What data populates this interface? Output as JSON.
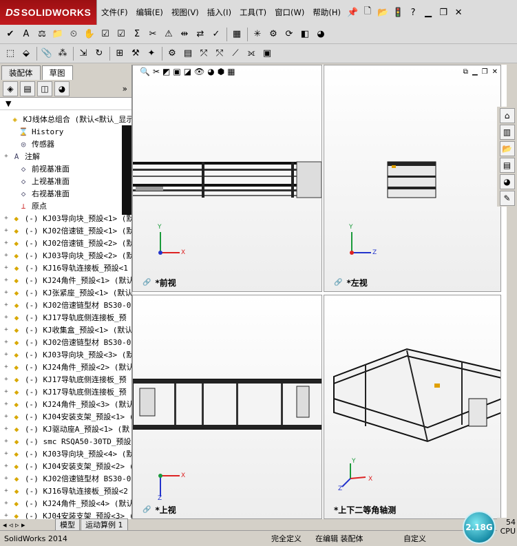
{
  "app": {
    "logo_ds": "DS",
    "logo_name": "SOLIDWORKS"
  },
  "menu": [
    "文件(F)",
    "编辑(E)",
    "视图(V)",
    "插入(I)",
    "工具(T)",
    "窗口(W)",
    "帮助(H)"
  ],
  "left_panel": {
    "tabs": [
      "装配体",
      "草图"
    ],
    "filter_icon": "filter-icon",
    "tree": [
      {
        "exp": "",
        "icon": "assembly-icon",
        "label": "KJ线体总组合  (默认<默认_显示"
      },
      {
        "exp": "",
        "icon": "history-icon",
        "label": "History"
      },
      {
        "exp": "",
        "icon": "sensor-icon",
        "label": "传感器"
      },
      {
        "exp": "+",
        "icon": "annotation-icon",
        "label": "注解"
      },
      {
        "exp": "",
        "icon": "plane-icon",
        "label": "前视基准面"
      },
      {
        "exp": "",
        "icon": "plane-icon",
        "label": "上视基准面"
      },
      {
        "exp": "",
        "icon": "plane-icon",
        "label": "右视基准面"
      },
      {
        "exp": "",
        "icon": "origin-icon",
        "label": "原点"
      },
      {
        "exp": "+",
        "icon": "part-icon",
        "label": "(-) KJ03导向块_预設<1> (默"
      },
      {
        "exp": "+",
        "icon": "part-icon",
        "label": "(-) KJ02倍速链_预設<1> (默"
      },
      {
        "exp": "+",
        "icon": "part-icon",
        "label": "(-) KJ02倍速链_预設<2> (默"
      },
      {
        "exp": "+",
        "icon": "part-icon",
        "label": "(-) KJ03导向块_预設<2> (默"
      },
      {
        "exp": "+",
        "icon": "part-icon",
        "label": "(-) KJ16导轨连接板_预設<1"
      },
      {
        "exp": "+",
        "icon": "part-icon",
        "label": "(-) KJ24角件_预設<1> (默认"
      },
      {
        "exp": "+",
        "icon": "part-icon",
        "label": "(-) KJ张紧座_预設<1> (默认"
      },
      {
        "exp": "+",
        "icon": "part-icon",
        "label": "(-) KJ02倍速链型材 BS30-0"
      },
      {
        "exp": "+",
        "icon": "part-icon",
        "label": "(-) KJ17导轨底侧连接板_预"
      },
      {
        "exp": "+",
        "icon": "part-icon",
        "label": "(-) KJ收集盒_预設<1> (默认"
      },
      {
        "exp": "+",
        "icon": "part-icon",
        "label": "(-) KJ02倍速链型材 BS30-0"
      },
      {
        "exp": "+",
        "icon": "part-icon",
        "label": "(-) KJ03导向块_预設<3> (默"
      },
      {
        "exp": "+",
        "icon": "part-icon",
        "label": "(-) KJ24角件_预設<2> (默认"
      },
      {
        "exp": "+",
        "icon": "part-icon",
        "label": "(-) KJ17导轨底侧连接板_预"
      },
      {
        "exp": "+",
        "icon": "part-icon",
        "label": "(-) KJ17导轨底侧连接板_预"
      },
      {
        "exp": "+",
        "icon": "part-icon",
        "label": "(-) KJ24角件_预設<3> (默认"
      },
      {
        "exp": "+",
        "icon": "part-icon",
        "label": "(-) KJ04安装支架_预設<1> ("
      },
      {
        "exp": "+",
        "icon": "part-icon",
        "label": "(-) KJ驱动座A_预設<1> (默"
      },
      {
        "exp": "+",
        "icon": "part-icon",
        "label": "(-) smc RSQA50-30TD_预設"
      },
      {
        "exp": "+",
        "icon": "part-icon",
        "label": "(-) KJ03导向块_预設<4> (默"
      },
      {
        "exp": "+",
        "icon": "part-icon",
        "label": "(-) KJ04安装支架_预設<2> ("
      },
      {
        "exp": "+",
        "icon": "part-icon",
        "label": "(-) KJ02倍速链型材 BS30-0"
      },
      {
        "exp": "+",
        "icon": "part-icon",
        "label": "(-) KJ16导轨连接板_预設<2"
      },
      {
        "exp": "+",
        "icon": "part-icon",
        "label": "(-) KJ24角件_预設<4> (默认"
      },
      {
        "exp": "+",
        "icon": "part-icon",
        "label": "(-) KJ04安装支架_预設<3> ("
      }
    ]
  },
  "viewports": [
    {
      "label": "*前视",
      "axes": [
        "Y",
        "X"
      ]
    },
    {
      "label": "*左视",
      "axes": [
        "Y",
        "Z"
      ]
    },
    {
      "label": "*上视",
      "axes": [
        "X",
        "Z"
      ]
    },
    {
      "label": "*上下二等角轴测",
      "axes": [
        "Y",
        "X",
        "Z"
      ]
    }
  ],
  "bottom_tabs": [
    "模型",
    "运动算例 1"
  ],
  "status": {
    "app": "SolidWorks 2014",
    "state": "完全定义",
    "edit": "在编辑 装配体",
    "custom": "自定义",
    "cpu_value": "2.18G",
    "cpu_side_value": "54",
    "cpu_side_label": "CPU"
  },
  "colors": {
    "title_red": "#b3141a",
    "axis_x": "#d22",
    "axis_y": "#1a9a3a",
    "axis_z": "#2233cc"
  }
}
